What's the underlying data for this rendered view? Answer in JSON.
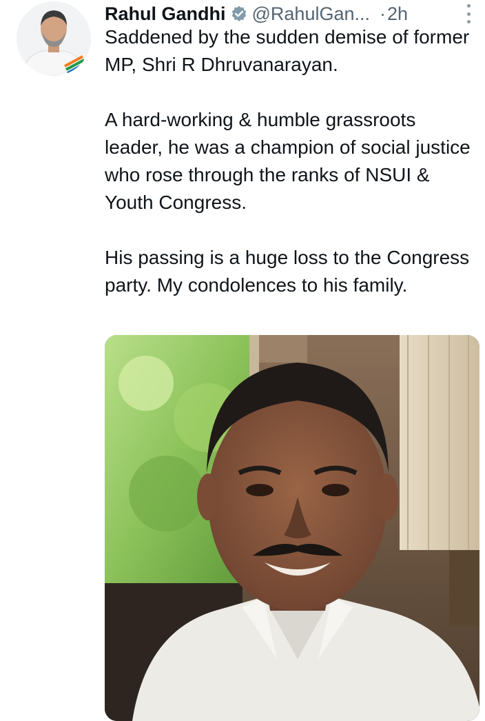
{
  "tweet": {
    "author_name": "Rahul Gandhi",
    "handle": "@RahulGan...",
    "separator": "·",
    "time": "2h",
    "paragraphs": [
      "Saddened by the sudden demise of former MP, Shri R Dhruvanarayan.",
      "A hard-working & humble grassroots leader, he was a champion of social justice who rose through the ranks of NSUI & Youth Congress.",
      "His passing is a huge loss to the Congress party. My condolences to his family."
    ]
  },
  "icons": {
    "verified": "verified-badge-icon",
    "more": "more-vertical-icon"
  },
  "colors": {
    "text": "#0f1419",
    "secondary": "#536471",
    "badge": "#829aab"
  }
}
